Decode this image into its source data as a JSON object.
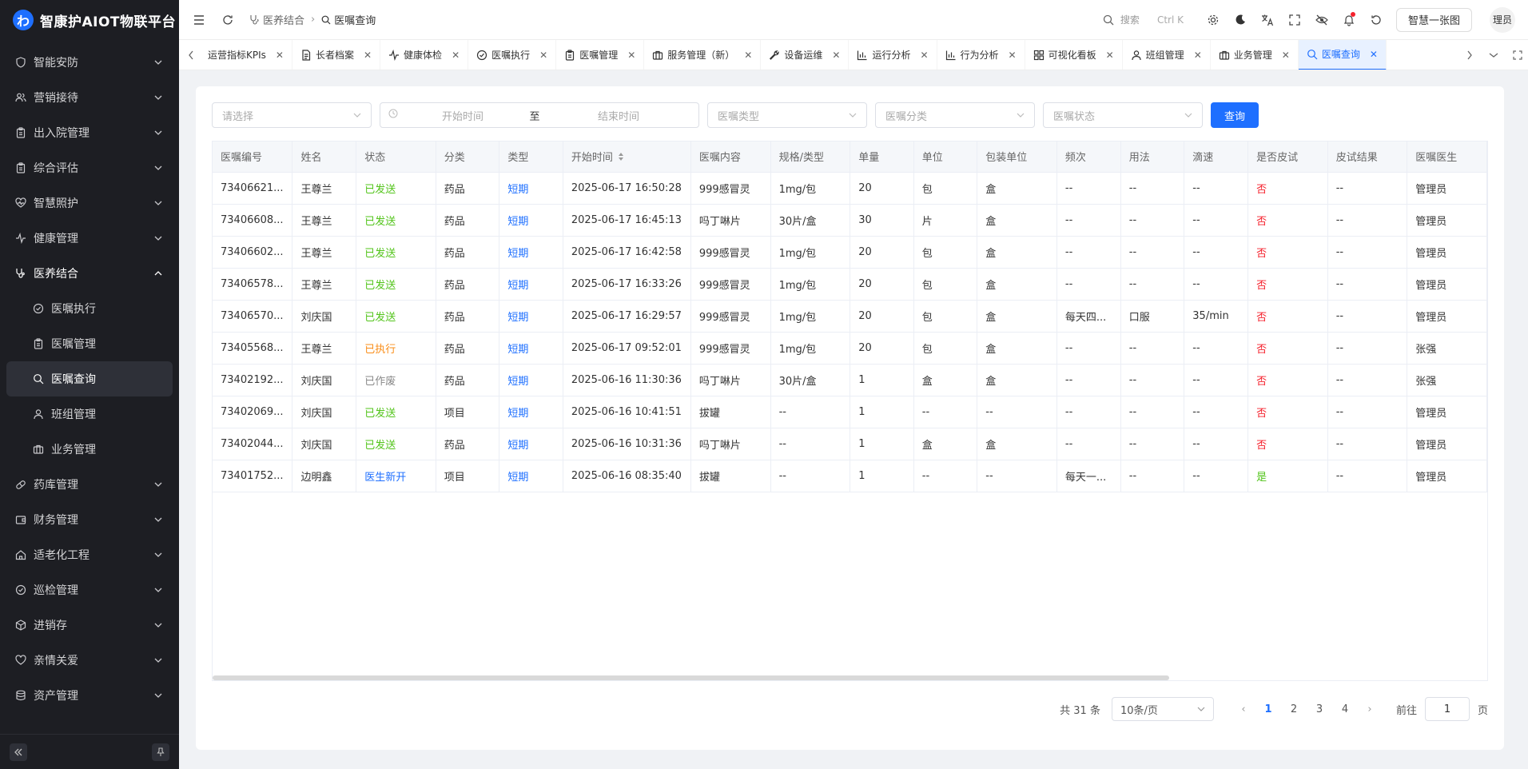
{
  "app": {
    "title": "智康护AIOT物联平台",
    "logo_glyph": "わ"
  },
  "sidebar": {
    "items": [
      {
        "label": "智能安防",
        "icon": "shield-icon",
        "expanded": false
      },
      {
        "label": "营销接待",
        "icon": "users-icon",
        "expanded": false
      },
      {
        "label": "出入院管理",
        "icon": "clipboard-icon",
        "expanded": false
      },
      {
        "label": "综合评估",
        "icon": "clipboard-icon",
        "expanded": false
      },
      {
        "label": "智慧照护",
        "icon": "heart-pulse-icon",
        "expanded": false
      },
      {
        "label": "健康管理",
        "icon": "activity-icon",
        "expanded": false
      },
      {
        "label": "医养结合",
        "icon": "stethoscope-icon",
        "expanded": true
      }
    ],
    "subitems": [
      {
        "label": "医嘱执行",
        "icon": "check-circle-icon",
        "active": false
      },
      {
        "label": "医嘱管理",
        "icon": "clipboard-icon",
        "active": false
      },
      {
        "label": "医嘱查询",
        "icon": "search-icon",
        "active": true
      },
      {
        "label": "班组管理",
        "icon": "user-icon",
        "active": false
      },
      {
        "label": "业务管理",
        "icon": "briefcase-icon",
        "active": false
      }
    ],
    "items_after": [
      {
        "label": "药库管理",
        "icon": "pill-icon"
      },
      {
        "label": "财务管理",
        "icon": "wallet-icon"
      },
      {
        "label": "适老化工程",
        "icon": "home-icon"
      },
      {
        "label": "巡检管理",
        "icon": "check-circle-icon"
      },
      {
        "label": "进销存",
        "icon": "box-icon"
      },
      {
        "label": "亲情关爱",
        "icon": "heart-icon"
      },
      {
        "label": "资产管理",
        "icon": "database-icon"
      }
    ]
  },
  "topbar": {
    "breadcrumb": [
      "医养结合",
      "医嘱查询"
    ],
    "search_label": "搜索",
    "search_shortcut": "Ctrl K",
    "screen_button": "智慧一张图",
    "user": "理员"
  },
  "tabs": [
    {
      "label": "运营指标KPIs",
      "icon": "none",
      "active": false
    },
    {
      "label": "长者档案",
      "icon": "file-icon",
      "active": false
    },
    {
      "label": "健康体检",
      "icon": "activity-icon",
      "active": false
    },
    {
      "label": "医嘱执行",
      "icon": "check-circle-icon",
      "active": false
    },
    {
      "label": "医嘱管理",
      "icon": "clipboard-icon",
      "active": false
    },
    {
      "label": "服务管理（新）",
      "icon": "briefcase-icon",
      "active": false
    },
    {
      "label": "设备运维",
      "icon": "wrench-icon",
      "active": false
    },
    {
      "label": "运行分析",
      "icon": "bar-chart-icon",
      "active": false
    },
    {
      "label": "行为分析",
      "icon": "bar-chart-icon",
      "active": false
    },
    {
      "label": "可视化看板",
      "icon": "grid-icon",
      "active": false
    },
    {
      "label": "班组管理",
      "icon": "user-icon",
      "active": false
    },
    {
      "label": "业务管理",
      "icon": "briefcase-icon",
      "active": false
    },
    {
      "label": "医嘱查询",
      "icon": "search-icon",
      "active": true
    }
  ],
  "filters": {
    "select_placeholder": "请选择",
    "start_placeholder": "开始时间",
    "range_sep": "至",
    "end_placeholder": "结束时间",
    "type_placeholder": "医嘱类型",
    "category_placeholder": "医嘱分类",
    "status_placeholder": "医嘱状态",
    "query_label": "查询"
  },
  "table": {
    "columns": [
      "医嘱编号",
      "姓名",
      "状态",
      "分类",
      "类型",
      "开始时间",
      "医嘱内容",
      "规格/类型",
      "单量",
      "单位",
      "包装单位",
      "频次",
      "用法",
      "滴速",
      "是否皮试",
      "皮试结果",
      "医嘱医生"
    ],
    "rows": [
      [
        "73406621...",
        "王尊兰",
        "已发送",
        "药品",
        "短期",
        "2025-06-17 16:50:28",
        "999感冒灵",
        "1mg/包",
        "20",
        "包",
        "盒",
        "--",
        "--",
        "--",
        "否",
        "--",
        "管理员"
      ],
      [
        "73406608...",
        "王尊兰",
        "已发送",
        "药品",
        "短期",
        "2025-06-17 16:45:13",
        "吗丁啉片",
        "30片/盒",
        "30",
        "片",
        "盒",
        "--",
        "--",
        "--",
        "否",
        "--",
        "管理员"
      ],
      [
        "73406602...",
        "王尊兰",
        "已发送",
        "药品",
        "短期",
        "2025-06-17 16:42:58",
        "999感冒灵",
        "1mg/包",
        "20",
        "包",
        "盒",
        "--",
        "--",
        "--",
        "否",
        "--",
        "管理员"
      ],
      [
        "73406578...",
        "王尊兰",
        "已发送",
        "药品",
        "短期",
        "2025-06-17 16:33:26",
        "999感冒灵",
        "1mg/包",
        "20",
        "包",
        "盒",
        "--",
        "--",
        "--",
        "否",
        "--",
        "管理员"
      ],
      [
        "73406570...",
        "刘庆国",
        "已发送",
        "药品",
        "短期",
        "2025-06-17 16:29:57",
        "999感冒灵",
        "1mg/包",
        "20",
        "包",
        "盒",
        "每天四...",
        "口服",
        "35/min",
        "否",
        "--",
        "管理员"
      ],
      [
        "73405568...",
        "王尊兰",
        "已执行",
        "药品",
        "短期",
        "2025-06-17 09:52:01",
        "999感冒灵",
        "1mg/包",
        "20",
        "包",
        "盒",
        "--",
        "--",
        "--",
        "否",
        "--",
        "张强"
      ],
      [
        "73402192...",
        "刘庆国",
        "已作废",
        "药品",
        "短期",
        "2025-06-16 11:30:36",
        "吗丁啉片",
        "30片/盒",
        "1",
        "盒",
        "盒",
        "--",
        "--",
        "--",
        "否",
        "--",
        "张强"
      ],
      [
        "73402069...",
        "刘庆国",
        "已发送",
        "项目",
        "短期",
        "2025-06-16 10:41:51",
        "拔罐",
        "--",
        "1",
        "--",
        "--",
        "--",
        "--",
        "--",
        "否",
        "--",
        "管理员"
      ],
      [
        "73402044...",
        "刘庆国",
        "已发送",
        "药品",
        "短期",
        "2025-06-16 10:31:36",
        "吗丁啉片",
        "--",
        "1",
        "盒",
        "盒",
        "--",
        "--",
        "--",
        "否",
        "--",
        "管理员"
      ],
      [
        "73401752...",
        "边明鑫",
        "医生新开",
        "项目",
        "短期",
        "2025-06-16 08:35:40",
        "拔罐",
        "--",
        "1",
        "--",
        "--",
        "每天一...",
        "--",
        "--",
        "是",
        "--",
        "管理员"
      ]
    ]
  },
  "pagination": {
    "total": "共 31 条",
    "page_size": "10条/页",
    "pages": [
      "1",
      "2",
      "3",
      "4"
    ],
    "current": "1",
    "goto_label": "前往",
    "goto_value": "1",
    "page_unit": "页"
  },
  "colors": {
    "accent": "#1e6fff",
    "sent": "#52c41a",
    "executed": "#fa8c16",
    "void": "#888888",
    "new": "#1e6fff",
    "no": "#f5222d",
    "yes": "#52c41a"
  }
}
